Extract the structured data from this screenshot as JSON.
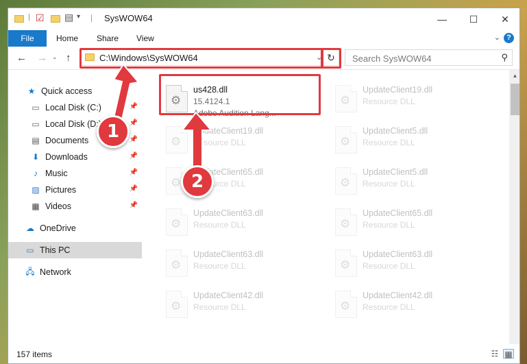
{
  "window": {
    "title": "SysWOW64",
    "controls": {
      "minimize": "—",
      "maximize": "☐",
      "close": "✕"
    }
  },
  "ribbon": {
    "tabs": [
      "File",
      "Home",
      "Share",
      "View"
    ],
    "help": "?"
  },
  "address": {
    "path": "C:\\Windows\\SysWOW64",
    "search_placeholder": "Search SysWOW64"
  },
  "nav": {
    "items": [
      {
        "label": "Quick access",
        "icon": "star-icon"
      },
      {
        "label": "Local Disk (C:)",
        "icon": "drive-icon"
      },
      {
        "label": "Local Disk (D:)",
        "icon": "drive-icon"
      },
      {
        "label": "Documents",
        "icon": "documents-icon"
      },
      {
        "label": "Downloads",
        "icon": "download-icon"
      },
      {
        "label": "Music",
        "icon": "music-icon"
      },
      {
        "label": "Pictures",
        "icon": "pictures-icon"
      },
      {
        "label": "Videos",
        "icon": "videos-icon"
      },
      {
        "label": "OneDrive",
        "icon": "cloud-icon"
      },
      {
        "label": "This PC",
        "icon": "pc-icon"
      },
      {
        "label": "Network",
        "icon": "network-icon"
      }
    ]
  },
  "files": [
    {
      "name": "us428.dll",
      "line1": "15.4124.1",
      "line2": "Adobe Audition Lang..."
    },
    {
      "name": "UpdateClient19.dll",
      "line1": "Resource DLL"
    },
    {
      "name": "UpdateClient19.dll",
      "line1": "Resource DLL"
    },
    {
      "name": "UpdateClient5.dll",
      "line1": "Resource DLL"
    },
    {
      "name": "UpdateClient65.dll",
      "line1": "Resource DLL"
    },
    {
      "name": "UpdateClient5.dll",
      "line1": "Resource DLL"
    },
    {
      "name": "UpdateClient63.dll",
      "line1": "Resource DLL"
    },
    {
      "name": "UpdateClient65.dll",
      "line1": "Resource DLL"
    },
    {
      "name": "UpdateClient63.dll",
      "line1": "Resource DLL"
    },
    {
      "name": "UpdateClient63.dll",
      "line1": "Resource DLL"
    },
    {
      "name": "UpdateClient42.dll",
      "line1": "Resource DLL"
    },
    {
      "name": "UpdateClient42.dll",
      "line1": "Resource DLL"
    }
  ],
  "status": {
    "items_count": "157 items"
  },
  "annotations": {
    "step1": "1",
    "step2": "2",
    "color": "#e0393e"
  }
}
